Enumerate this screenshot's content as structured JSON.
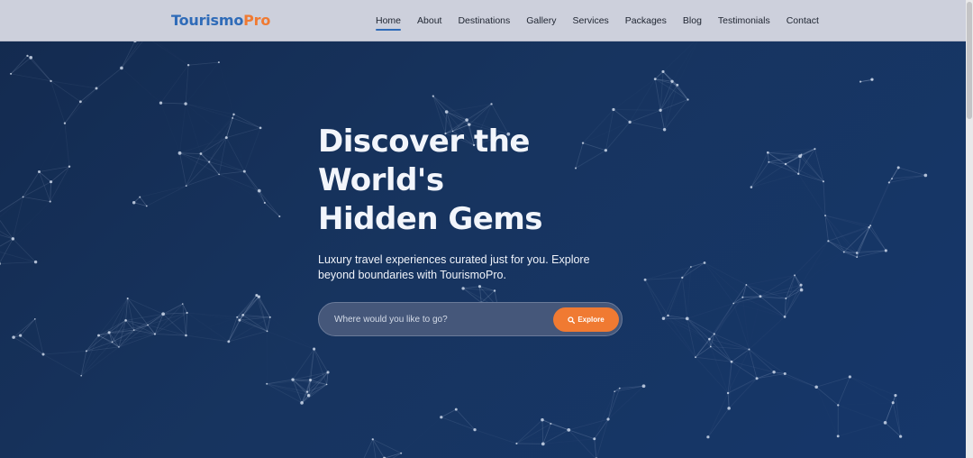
{
  "brand": {
    "part1": "Tourismo",
    "part2": "Pro",
    "color1": "#2f6bb8",
    "color2": "#f07a32"
  },
  "nav": {
    "items": [
      {
        "label": "Home",
        "active": true
      },
      {
        "label": "About"
      },
      {
        "label": "Destinations"
      },
      {
        "label": "Gallery"
      },
      {
        "label": "Services"
      },
      {
        "label": "Packages"
      },
      {
        "label": "Blog"
      },
      {
        "label": "Testimonials"
      },
      {
        "label": "Contact"
      }
    ]
  },
  "hero": {
    "headline": [
      "Discover the",
      "World's",
      "Hidden Gems"
    ],
    "subtitle": "Luxury travel experiences curated just for you. Explore beyond boundaries with TourismoPro.",
    "search_placeholder": "Where would you like to go?",
    "search_value": "",
    "button_label": "Explore",
    "button_icon": "search-icon",
    "accent_color": "#f07a32"
  }
}
